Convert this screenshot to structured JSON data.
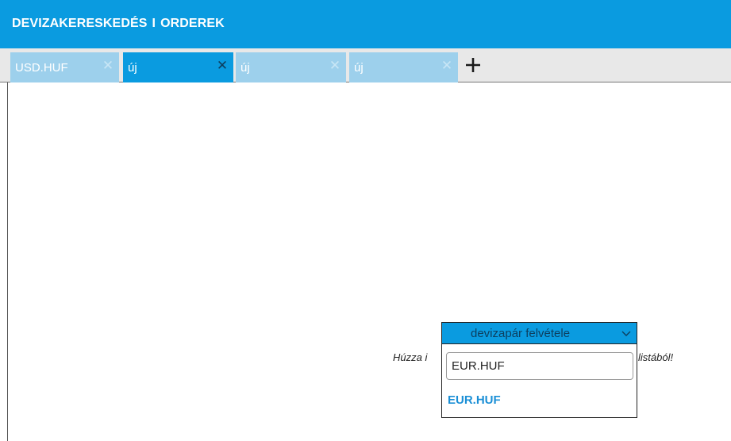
{
  "header": {
    "title_left": "DEVIZAKERESKEDÉS",
    "title_sep": "I",
    "title_right": "ORDEREK"
  },
  "tabs": [
    {
      "label": "USD.HUF",
      "active": false
    },
    {
      "label": "új",
      "active": true
    },
    {
      "label": "új",
      "active": false
    },
    {
      "label": "új",
      "active": false
    }
  ],
  "icons": {
    "close": "close-icon",
    "add": "plus-icon",
    "dropdown": "chevron-down-icon"
  },
  "dropdown": {
    "header_label": "devizapár felvétele",
    "search_value": "EUR.HUF",
    "options": [
      "EUR.HUF"
    ]
  },
  "hint": {
    "start": "Húzza i",
    "end": "listából!"
  },
  "colors": {
    "accent": "#0a9be0",
    "tab_inactive": "#9dd0ec",
    "option_text": "#1a8fd6"
  }
}
